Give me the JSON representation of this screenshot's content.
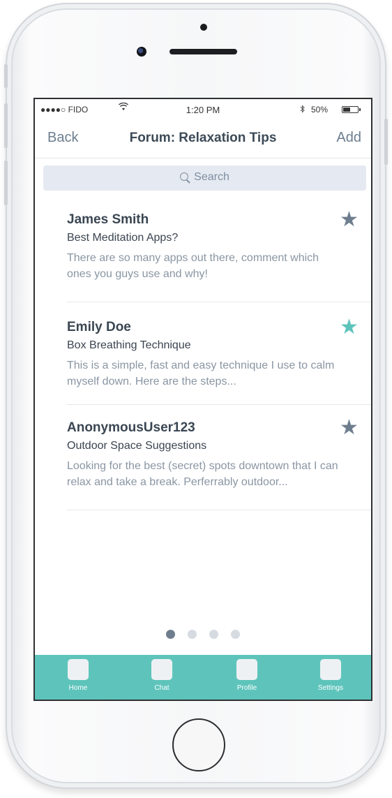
{
  "status_bar": {
    "carrier": "●●●●○ FIDO",
    "time": "1:20 PM",
    "battery": "50%",
    "battery_level": 0.5
  },
  "nav": {
    "back_label": "Back",
    "title": "Forum: Relaxation Tips",
    "add_label": "Add"
  },
  "search": {
    "placeholder": "Search"
  },
  "posts": [
    {
      "author": "James Smith",
      "title": "Best Meditation Apps?",
      "excerpt": "There are so many apps out there, comment which ones you guys use and why!",
      "starred": false
    },
    {
      "author": "Emily Doe",
      "title": "Box Breathing Technique",
      "excerpt": "This is a simple, fast and easy technique I use to calm myself down. Here are the steps...",
      "starred": true
    },
    {
      "author": "AnonymousUser123",
      "title": "Outdoor Space Suggestions",
      "excerpt": "Looking for the best (secret) spots downtown that I can relax and take a break. Perferrably outdoor...",
      "starred": false
    }
  ],
  "pager": {
    "page_count": 4,
    "current_page": 1
  },
  "tabs": [
    {
      "label": "Home",
      "icon": "home-icon"
    },
    {
      "label": "Chat",
      "icon": "chat-icon"
    },
    {
      "label": "Profile",
      "icon": "profile-icon"
    },
    {
      "label": "Settings",
      "icon": "settings-icon"
    }
  ],
  "colors": {
    "accent": "#5ec4bb",
    "star_active": "#5ec4bb",
    "star_inactive": "#6f7e8e",
    "nav_text": "#6c7e8f",
    "search_bg": "#e5e9f1"
  }
}
